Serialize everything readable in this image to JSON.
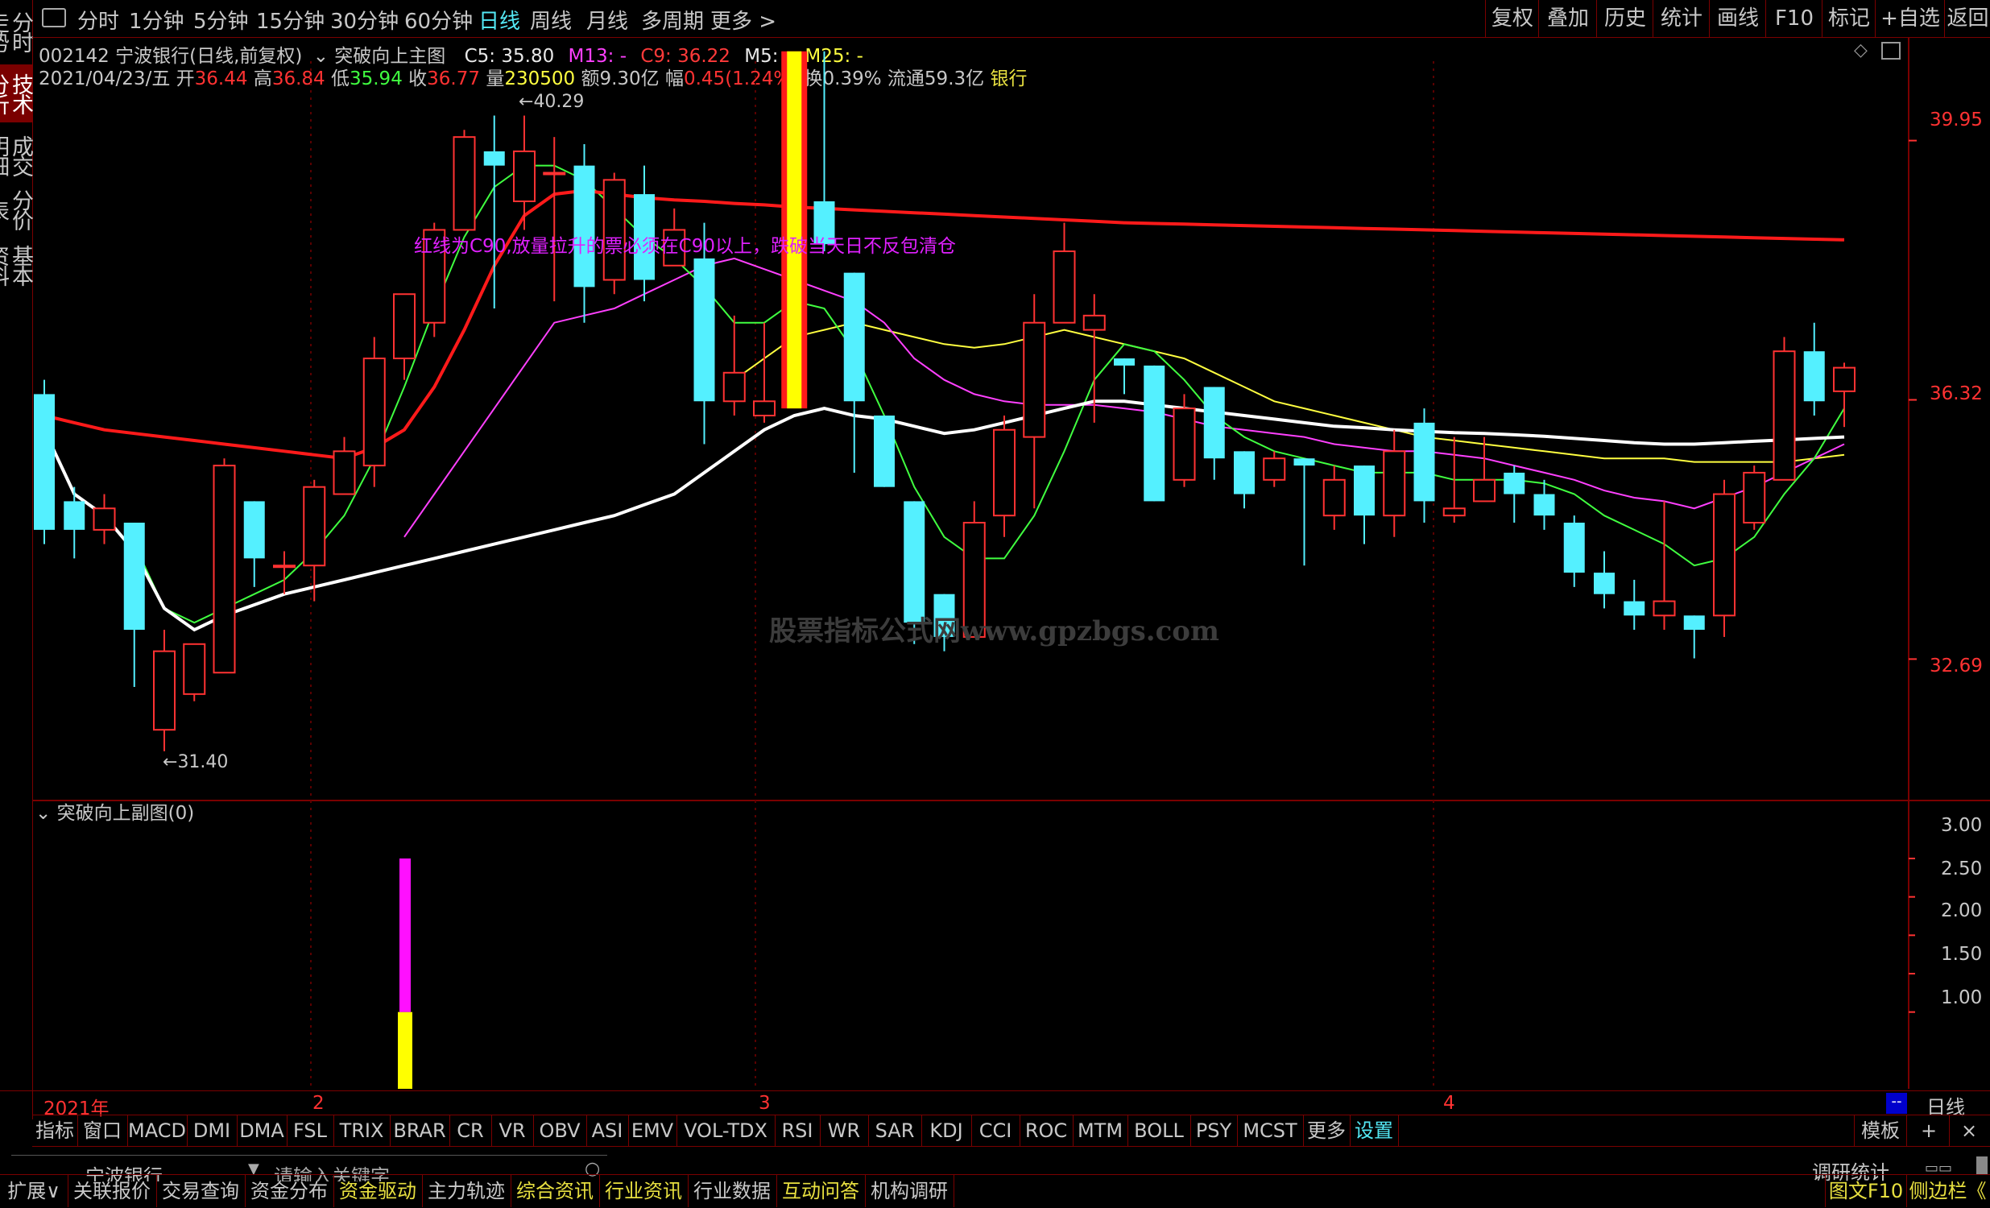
{
  "left_tabs": [
    "分时走势",
    "技术分析",
    "成交明细",
    "分价表",
    "基本资料"
  ],
  "top_toolbar": {
    "periods": [
      "分时",
      "1分钟",
      "5分钟",
      "15分钟",
      "30分钟",
      "60分钟",
      "日线",
      "周线",
      "月线",
      "多周期",
      "更多 >"
    ],
    "selected_period": "日线",
    "right_buttons": [
      "复权",
      "叠加",
      "历史",
      "统计",
      "画线",
      "F10",
      "标记",
      "+自选",
      "返回"
    ]
  },
  "header": {
    "stock_code": "002142",
    "stock_name": "宁波银行",
    "mode": "(日线,前复权)",
    "indicator_name": "突破向上主图",
    "c5": "C5: 35.80",
    "m13": "M13: -",
    "c9": "C9: 36.22",
    "m5": "M5: -",
    "m25": "M25: -",
    "date": "2021/04/23/五",
    "open_label": "开",
    "open": "36.44",
    "high_label": "高",
    "high": "36.84",
    "low_label": "低",
    "low": "35.94",
    "close_label": "收",
    "close": "36.77",
    "volume_label": "量",
    "volume": "230500",
    "amount": "额9.30亿",
    "change_label": "幅",
    "change": "0.45(1.24%)",
    "turnover": "换0.39%",
    "float": "流通59.3亿",
    "sector": "银行"
  },
  "annotation": "红线为C90,放量拉升的票必须在C90以上，跌破当天日不反包清仓",
  "watermark": "股票指标公式网www.gpzbgs.com",
  "price_labels": {
    "high_mark": "40.29",
    "low_mark": "31.40"
  },
  "y_axis_main": [
    "39.95",
    "36.32",
    "32.69"
  ],
  "y_axis_sub": [
    "3.00",
    "2.50",
    "2.00",
    "1.50",
    "1.00"
  ],
  "sub_chart_title": "突破向上副图(0)",
  "date_axis": [
    "2021年",
    "2",
    "3",
    "4"
  ],
  "period_label": "日线",
  "indicator_tabs": [
    "指标",
    "窗口",
    "MACD",
    "DMI",
    "DMA",
    "FSL",
    "TRIX",
    "BRAR",
    "CR",
    "VR",
    "OBV",
    "ASI",
    "EMV",
    "VOL-TDX",
    "RSI",
    "WR",
    "SAR",
    "KDJ",
    "CCI",
    "ROC",
    "MTM",
    "BOLL",
    "PSY",
    "MCST",
    "更多",
    "设置"
  ],
  "template_label": "模板",
  "search": {
    "stock": "宁波银行",
    "placeholder": "请输入关键字"
  },
  "research_label": "调研统计",
  "status_tabs": [
    "扩展∨",
    "关联报价",
    "交易查询",
    "资金分布",
    "资金驱动",
    "主力轨迹",
    "综合资讯",
    "行业资讯",
    "行业数据",
    "互动问答",
    "机构调研"
  ],
  "status_right": [
    "图文F10",
    "侧边栏《"
  ],
  "colors": {
    "up": "#ff3232",
    "down": "#54f0ff",
    "c90": "#ff1a1a",
    "c5": "#ffffff",
    "m13": "#ff40ff",
    "c9": "#ff3a3a",
    "m25": "#ffff40",
    "ma_green": "#40ff40",
    "border": "#7a0000"
  },
  "chart_data": {
    "type": "candlestick",
    "y_range": [
      30.8,
      41.4
    ],
    "candles": [
      {
        "o": 36.4,
        "h": 36.6,
        "c": 34.5,
        "l": 34.3
      },
      {
        "o": 34.9,
        "h": 35.1,
        "c": 34.5,
        "l": 34.1
      },
      {
        "o": 34.5,
        "h": 35.0,
        "c": 34.8,
        "l": 34.3
      },
      {
        "o": 34.6,
        "h": 34.6,
        "c": 33.1,
        "l": 32.3
      },
      {
        "o": 31.7,
        "h": 33.1,
        "c": 32.8,
        "l": 31.4
      },
      {
        "o": 32.2,
        "h": 32.9,
        "c": 32.9,
        "l": 32.1
      },
      {
        "o": 32.5,
        "h": 35.5,
        "c": 35.4,
        "l": 32.5
      },
      {
        "o": 34.9,
        "h": 34.9,
        "c": 34.1,
        "l": 33.7
      },
      {
        "o": 34.0,
        "h": 34.2,
        "c": 34.0,
        "l": 33.6
      },
      {
        "o": 34.0,
        "h": 35.2,
        "c": 35.1,
        "l": 33.5
      },
      {
        "o": 35.0,
        "h": 35.8,
        "c": 35.6,
        "l": 35.0
      },
      {
        "o": 35.4,
        "h": 37.2,
        "c": 36.9,
        "l": 35.1
      },
      {
        "o": 36.9,
        "h": 37.8,
        "c": 37.8,
        "l": 36.6
      },
      {
        "o": 37.4,
        "h": 38.8,
        "c": 38.7,
        "l": 37.2
      },
      {
        "o": 38.7,
        "h": 40.1,
        "c": 40.0,
        "l": 38.7
      },
      {
        "o": 39.8,
        "h": 40.3,
        "c": 39.6,
        "l": 37.6
      },
      {
        "o": 39.1,
        "h": 40.3,
        "c": 39.8,
        "l": 38.7
      },
      {
        "o": 39.5,
        "h": 40.0,
        "c": 39.5,
        "l": 37.7
      },
      {
        "o": 39.6,
        "h": 39.9,
        "c": 37.9,
        "l": 37.4
      },
      {
        "o": 38.0,
        "h": 39.5,
        "c": 39.4,
        "l": 37.8
      },
      {
        "o": 39.2,
        "h": 39.6,
        "c": 38.0,
        "l": 37.7
      },
      {
        "o": 38.2,
        "h": 39.0,
        "c": 38.7,
        "l": 38.4
      },
      {
        "o": 38.3,
        "h": 38.8,
        "c": 36.3,
        "l": 35.7
      },
      {
        "o": 36.3,
        "h": 37.5,
        "c": 36.7,
        "l": 36.1
      },
      {
        "o": 36.1,
        "h": 37.4,
        "c": 36.3,
        "l": 36.0
      },
      {
        "o": 36.2,
        "h": 41.2,
        "c": 41.2,
        "l": 36.2
      },
      {
        "o": 39.1,
        "h": 41.2,
        "c": 38.5,
        "l": 38.4
      },
      {
        "o": 38.1,
        "h": 38.1,
        "c": 36.3,
        "l": 35.3
      },
      {
        "o": 36.1,
        "h": 36.1,
        "c": 35.1,
        "l": 35.1
      },
      {
        "o": 34.9,
        "h": 34.9,
        "c": 33.2,
        "l": 32.9
      },
      {
        "o": 33.6,
        "h": 33.6,
        "c": 33.0,
        "l": 32.8
      },
      {
        "o": 33.0,
        "h": 34.9,
        "c": 34.6,
        "l": 33.0
      },
      {
        "o": 34.7,
        "h": 36.1,
        "c": 35.9,
        "l": 34.4
      },
      {
        "o": 35.8,
        "h": 37.8,
        "c": 37.4,
        "l": 34.8
      },
      {
        "o": 37.4,
        "h": 38.8,
        "c": 38.4,
        "l": 37.4
      },
      {
        "o": 37.3,
        "h": 37.8,
        "c": 37.5,
        "l": 36.0
      },
      {
        "o": 36.9,
        "h": 36.9,
        "c": 36.8,
        "l": 36.4
      },
      {
        "o": 36.8,
        "h": 36.8,
        "c": 34.9,
        "l": 34.9
      },
      {
        "o": 35.2,
        "h": 36.4,
        "c": 36.2,
        "l": 35.1
      },
      {
        "o": 36.5,
        "h": 36.5,
        "c": 35.5,
        "l": 35.2
      },
      {
        "o": 35.6,
        "h": 35.6,
        "c": 35.0,
        "l": 34.8
      },
      {
        "o": 35.2,
        "h": 35.6,
        "c": 35.5,
        "l": 35.1
      },
      {
        "o": 35.5,
        "h": 35.5,
        "c": 35.4,
        "l": 34.0
      },
      {
        "o": 34.7,
        "h": 35.4,
        "c": 35.2,
        "l": 34.5
      },
      {
        "o": 35.4,
        "h": 35.4,
        "c": 34.7,
        "l": 34.3
      },
      {
        "o": 34.7,
        "h": 35.9,
        "c": 35.6,
        "l": 34.4
      },
      {
        "o": 36.0,
        "h": 36.2,
        "c": 34.9,
        "l": 34.6
      },
      {
        "o": 34.7,
        "h": 35.8,
        "c": 34.8,
        "l": 34.6
      },
      {
        "o": 34.9,
        "h": 35.8,
        "c": 35.2,
        "l": 34.9
      },
      {
        "o": 35.3,
        "h": 35.4,
        "c": 35.0,
        "l": 34.6
      },
      {
        "o": 35.0,
        "h": 35.2,
        "c": 34.7,
        "l": 34.5
      },
      {
        "o": 34.6,
        "h": 34.7,
        "c": 33.9,
        "l": 33.7
      },
      {
        "o": 33.9,
        "h": 34.2,
        "c": 33.6,
        "l": 33.4
      },
      {
        "o": 33.5,
        "h": 33.8,
        "c": 33.3,
        "l": 33.1
      },
      {
        "o": 33.3,
        "h": 34.9,
        "c": 33.5,
        "l": 33.1
      },
      {
        "o": 33.3,
        "h": 33.3,
        "c": 33.1,
        "l": 32.7
      },
      {
        "o": 33.3,
        "h": 35.2,
        "c": 35.0,
        "l": 33.0
      },
      {
        "o": 34.6,
        "h": 35.4,
        "c": 35.3,
        "l": 34.5
      },
      {
        "o": 35.2,
        "h": 37.2,
        "c": 37.0,
        "l": 35.2
      },
      {
        "o": 37.0,
        "h": 37.4,
        "c": 36.3,
        "l": 36.1
      },
      {
        "o": 36.44,
        "h": 36.84,
        "c": 36.77,
        "l": 35.94
      }
    ],
    "c90": [
      36.1,
      36.0,
      35.9,
      35.85,
      35.8,
      35.75,
      35.7,
      35.65,
      35.6,
      35.55,
      35.5,
      35.65,
      35.9,
      36.5,
      37.3,
      38.2,
      38.9,
      39.2,
      39.25,
      39.2,
      39.15,
      39.12,
      39.1,
      39.07,
      39.05,
      39.02,
      39.0,
      38.98,
      38.96,
      38.94,
      38.92,
      38.9,
      38.88,
      38.86,
      38.84,
      38.82,
      38.8,
      38.79,
      38.78,
      38.77,
      38.76,
      38.75,
      38.74,
      38.73,
      38.72,
      38.71,
      38.7,
      38.69,
      38.68,
      38.67,
      38.66,
      38.65,
      38.64,
      38.63,
      38.62,
      38.61,
      38.6,
      38.59,
      38.58,
      38.57,
      38.56
    ],
    "c5": [
      35.9,
      35.0,
      34.7,
      34.2,
      33.4,
      33.1,
      33.3,
      33.45,
      33.6,
      33.7,
      33.8,
      33.9,
      34.0,
      34.1,
      34.2,
      34.3,
      34.4,
      34.5,
      34.6,
      34.7,
      34.85,
      35.0,
      35.3,
      35.6,
      35.9,
      36.1,
      36.2,
      36.1,
      36.05,
      35.95,
      35.85,
      35.9,
      36.0,
      36.1,
      36.2,
      36.3,
      36.3,
      36.25,
      36.2,
      36.15,
      36.1,
      36.05,
      36.0,
      35.95,
      35.93,
      35.9,
      35.88,
      35.86,
      35.85,
      35.83,
      35.81,
      35.78,
      35.75,
      35.72,
      35.7,
      35.7,
      35.72,
      35.74,
      35.76,
      35.78,
      35.8
    ],
    "c9": [
      null,
      null,
      null,
      null,
      null,
      null,
      null,
      null,
      null,
      null,
      null,
      null,
      34.4,
      35.0,
      35.6,
      36.2,
      36.8,
      37.4,
      37.5,
      37.6,
      37.8,
      38.0,
      38.2,
      38.3,
      38.15,
      38.0,
      37.85,
      37.7,
      37.4,
      36.9,
      36.6,
      36.4,
      36.3,
      36.25,
      36.25,
      36.25,
      36.2,
      36.15,
      36.05,
      35.95,
      35.9,
      35.85,
      35.8,
      35.7,
      35.65,
      35.6,
      35.6,
      35.55,
      35.5,
      35.4,
      35.3,
      35.2,
      35.05,
      34.95,
      34.9,
      34.8,
      34.95,
      35.1,
      35.3,
      35.5,
      35.7
    ],
    "m25": [
      null,
      null,
      null,
      null,
      null,
      null,
      null,
      null,
      null,
      null,
      null,
      null,
      null,
      null,
      null,
      null,
      null,
      null,
      null,
      null,
      null,
      null,
      null,
      36.6,
      36.9,
      37.2,
      37.3,
      37.4,
      37.3,
      37.2,
      37.1,
      37.05,
      37.1,
      37.2,
      37.3,
      37.2,
      37.1,
      37.0,
      36.9,
      36.7,
      36.5,
      36.3,
      36.2,
      36.1,
      36.0,
      35.9,
      35.8,
      35.75,
      35.7,
      35.65,
      35.6,
      35.55,
      35.5,
      35.5,
      35.5,
      35.45,
      35.45,
      35.45,
      35.45,
      35.5,
      35.55
    ],
    "ma_green": [
      null,
      null,
      null,
      34.3,
      33.4,
      33.2,
      33.4,
      33.6,
      33.8,
      34.2,
      34.7,
      35.5,
      36.5,
      37.6,
      38.6,
      39.3,
      39.6,
      39.6,
      39.4,
      39.0,
      38.6,
      38.3,
      37.9,
      37.4,
      37.4,
      37.7,
      37.6,
      37.0,
      36.1,
      35.1,
      34.4,
      34.1,
      34.1,
      34.7,
      35.6,
      36.6,
      37.1,
      37.0,
      36.6,
      36.1,
      35.8,
      35.6,
      35.5,
      35.4,
      35.3,
      35.3,
      35.3,
      35.2,
      35.2,
      35.2,
      35.15,
      35.0,
      34.7,
      34.5,
      34.3,
      34.0,
      34.1,
      34.4,
      35.0,
      35.5,
      36.2
    ],
    "sub_chart": {
      "y_range": [
        0,
        3.0
      ],
      "bar_index": 12,
      "yellow": [
        0,
        1.0
      ],
      "magenta": [
        1.0,
        3.0
      ]
    },
    "signal_candle_index": 25
  }
}
